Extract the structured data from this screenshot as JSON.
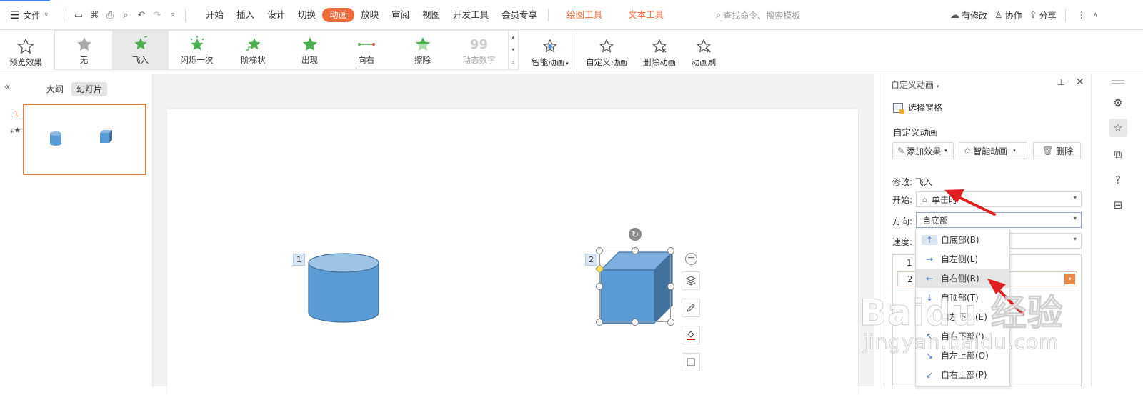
{
  "titlebar": {
    "file_label": "文件",
    "tabs": [
      "开始",
      "插入",
      "设计",
      "切换",
      "动画",
      "放映",
      "审阅",
      "视图",
      "开发工具",
      "会员专享"
    ],
    "active_tab": "动画",
    "context_tabs": [
      "绘图工具",
      "文本工具"
    ],
    "search_placeholder": "查找命令、搜索模板",
    "modified_label": "有修改",
    "collab_label": "协作",
    "share_label": "分享"
  },
  "ribbon": {
    "preview_label": "预览效果",
    "effects": [
      {
        "label": "无",
        "icon": "star-gray-icon"
      },
      {
        "label": "飞入",
        "icon": "fly-in-star-icon",
        "selected": true
      },
      {
        "label": "闪烁一次",
        "icon": "flash-star-icon"
      },
      {
        "label": "阶梯状",
        "icon": "stairs-star-icon"
      },
      {
        "label": "出现",
        "icon": "appear-star-icon"
      },
      {
        "label": "向右",
        "icon": "arrow-right-line-icon"
      },
      {
        "label": "擦除",
        "icon": "wipe-star-icon"
      },
      {
        "label": "动态数字",
        "icon": "dynamic-number-icon",
        "disabled": true
      }
    ],
    "smart_animation_label": "智能动画",
    "custom_animation_label": "自定义动画",
    "delete_animation_label": "删除动画",
    "animation_brush_label": "动画刷"
  },
  "left_panel": {
    "tab_outline": "大纲",
    "tab_slides": "幻灯片",
    "slide_number": "1"
  },
  "slide": {
    "shape1_tag": "1",
    "shape2_tag": "2"
  },
  "right_panel": {
    "title": "自定义动画",
    "selection_pane_label": "选择窗格",
    "section_title": "自定义动画",
    "add_effect_label": "添加效果",
    "smart_animation_label": "智能动画",
    "delete_label": "删除",
    "modify_label": "修改: 飞入",
    "start_label": "开始:",
    "start_value": "单击时",
    "direction_label": "方向:",
    "direction_value": "自底部",
    "speed_label": "速度:",
    "list_numbers": [
      "1",
      "2"
    ]
  },
  "direction_options": [
    {
      "label": "自底部(B)",
      "arrow": "↑"
    },
    {
      "label": "自左侧(L)",
      "arrow": "→"
    },
    {
      "label": "自右侧(R)",
      "arrow": "←",
      "highlighted": true
    },
    {
      "label": "自顶部(T)",
      "arrow": "↓"
    },
    {
      "label": "自左下部(E)",
      "arrow": "↗"
    },
    {
      "label": "自右下部(')",
      "arrow": "↖"
    },
    {
      "label": "自左上部(O)",
      "arrow": "↘"
    },
    {
      "label": "自右上部(P)",
      "arrow": "↙"
    }
  ],
  "watermark": {
    "logo": "Baidu 经验",
    "url": "jingyan.baidu.com"
  },
  "colors": {
    "accent": "#ef6b3a",
    "shape_fill": "#5b9bd5",
    "shape_stroke": "#41719c",
    "red_arrow": "#e02020"
  }
}
